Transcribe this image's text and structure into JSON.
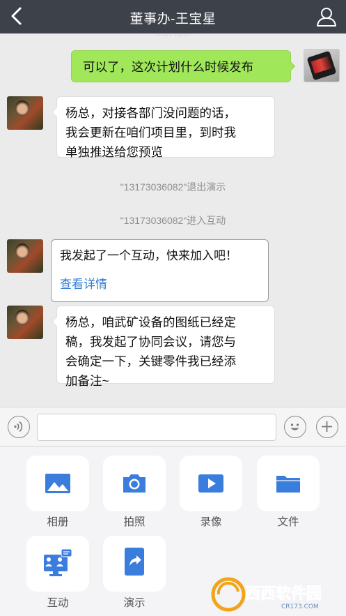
{
  "header": {
    "title": "董事办-王宝星"
  },
  "chat": {
    "clipped_time": "…… ……",
    "messages": [
      {
        "type": "text",
        "side": "right",
        "text": "可以了，这次计划什么时候发布"
      },
      {
        "type": "text",
        "side": "left",
        "lines": [
          "杨总，对接各部门没问题的话，",
          "我会更新在咱们项目里，到时我",
          "单独推送给您预览"
        ]
      },
      {
        "type": "system",
        "text": "\"13173036082\"退出演示"
      },
      {
        "type": "system",
        "text": "\"13173036082\"进入互动"
      },
      {
        "type": "card",
        "side": "left",
        "text": "我发起了一个互动，快来加入吧！",
        "link": "查看详情"
      },
      {
        "type": "text",
        "side": "left",
        "lines": [
          "杨总，咱武矿设备的图纸已经定",
          "稿，我发起了协同会议，请您与",
          "会确定一下，关键零件我已经添",
          "加备注~"
        ]
      }
    ]
  },
  "input": {
    "value": "",
    "placeholder": ""
  },
  "panel": {
    "items": [
      {
        "label": "相册",
        "icon": "image-icon"
      },
      {
        "label": "拍照",
        "icon": "camera-icon"
      },
      {
        "label": "录像",
        "icon": "video-icon"
      },
      {
        "label": "文件",
        "icon": "folder-icon"
      },
      {
        "label": "互动",
        "icon": "interaction-icon"
      },
      {
        "label": "演示",
        "icon": "share-icon"
      }
    ]
  },
  "watermark": {
    "brand": "西西软件园",
    "domain": "CR173.COM"
  },
  "colors": {
    "header_bg": "#3d4149",
    "sent_bubble": "#a0e75a",
    "link": "#2f7dd6",
    "icon_blue": "#3b7ddd"
  }
}
